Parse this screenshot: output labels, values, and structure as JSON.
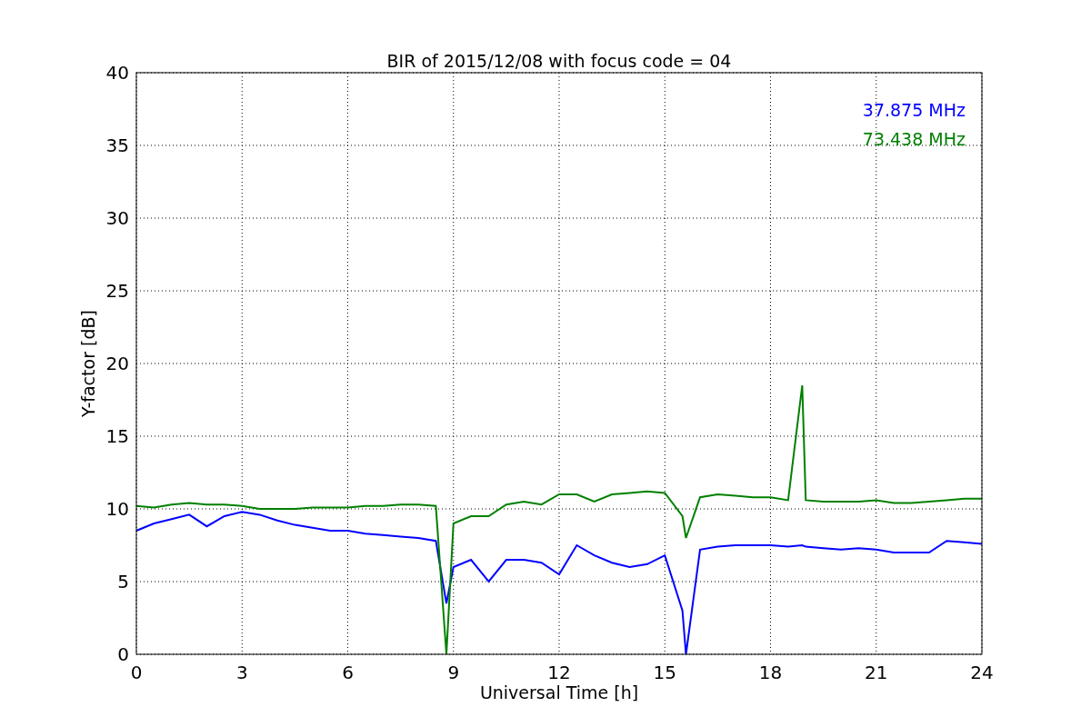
{
  "chart_data": {
    "type": "line",
    "grid": true,
    "title": "BIR of 2015/12/08 with focus code = 04",
    "xlabel": "Universal Time [h]",
    "ylabel": "Y-factor [dB]",
    "xlim": [
      0,
      24
    ],
    "ylim": [
      0,
      40
    ],
    "xticks": [
      0,
      3,
      6,
      9,
      12,
      15,
      18,
      21,
      24
    ],
    "yticks": [
      0,
      5,
      10,
      15,
      20,
      25,
      30,
      35,
      40
    ],
    "x": [
      0,
      0.5,
      1,
      1.5,
      2,
      2.5,
      3,
      3.5,
      4,
      4.5,
      5,
      5.5,
      6,
      6.5,
      7,
      7.5,
      8,
      8.5,
      8.8,
      9,
      9.5,
      10,
      10.5,
      11,
      11.5,
      12,
      12.5,
      13,
      13.5,
      14,
      14.5,
      15,
      15.5,
      15.6,
      16,
      16.5,
      17,
      17.5,
      18,
      18.5,
      18.9,
      19,
      19.5,
      20,
      20.5,
      21,
      21.5,
      22,
      22.5,
      23,
      23.5,
      24
    ],
    "series": [
      {
        "name": "37.875 MHz",
        "color": "#0000ff",
        "values": [
          8.5,
          9,
          9.3,
          9.6,
          8.8,
          9.5,
          9.8,
          9.6,
          9.2,
          8.9,
          8.7,
          8.5,
          8.5,
          8.3,
          8.2,
          8.1,
          8,
          7.8,
          3.5,
          6,
          6.5,
          5,
          6.5,
          6.5,
          6.3,
          5.5,
          7.5,
          6.8,
          6.3,
          6,
          6.2,
          6.8,
          3,
          0,
          7.2,
          7.4,
          7.5,
          7.5,
          7.5,
          7.4,
          7.5,
          7.4,
          7.3,
          7.2,
          7.3,
          7.2,
          7,
          7,
          7,
          7.8,
          7.7,
          7.6
        ]
      },
      {
        "name": "73.438 MHz",
        "color": "#008000",
        "values": [
          10.2,
          10.1,
          10.3,
          10.4,
          10.3,
          10.3,
          10.2,
          10,
          10,
          10,
          10.1,
          10.1,
          10.1,
          10.2,
          10.2,
          10.3,
          10.3,
          10.2,
          0,
          9,
          9.5,
          9.5,
          10.3,
          10.5,
          10.3,
          11,
          11,
          10.5,
          11,
          11.1,
          11.2,
          11.1,
          9.5,
          8,
          10.8,
          11,
          10.9,
          10.8,
          10.8,
          10.6,
          18.5,
          10.6,
          10.5,
          10.5,
          10.5,
          10.6,
          10.4,
          10.4,
          10.5,
          10.6,
          10.7,
          10.7
        ]
      }
    ]
  }
}
